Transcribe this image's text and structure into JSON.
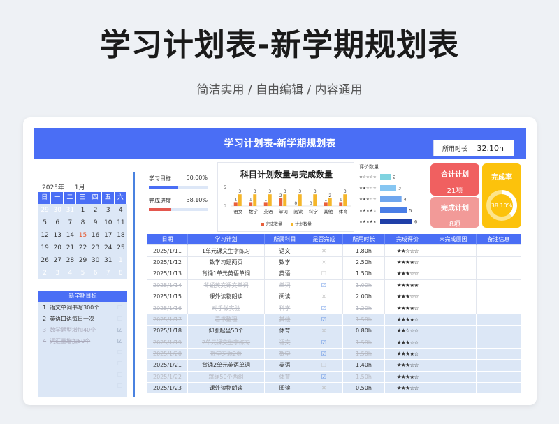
{
  "hero": {
    "title": "学习计划表-新学期规划表",
    "subtitle": "简洁实用 / 自由编辑 / 内容通用"
  },
  "sheet": {
    "title": "学习计划表-新学期规划表",
    "time_used_label": "所用时长",
    "time_used_value": "32.10h"
  },
  "calendar": {
    "year": "2025年",
    "month": "1月",
    "weekdays": [
      "日",
      "一",
      "二",
      "三",
      "四",
      "五",
      "六"
    ],
    "days": [
      {
        "d": "29",
        "m": true
      },
      {
        "d": "30",
        "m": true
      },
      {
        "d": "31",
        "m": true
      },
      {
        "d": "1"
      },
      {
        "d": "2"
      },
      {
        "d": "3"
      },
      {
        "d": "4"
      },
      {
        "d": "5"
      },
      {
        "d": "6"
      },
      {
        "d": "7"
      },
      {
        "d": "8"
      },
      {
        "d": "9"
      },
      {
        "d": "10"
      },
      {
        "d": "11"
      },
      {
        "d": "12"
      },
      {
        "d": "13"
      },
      {
        "d": "14"
      },
      {
        "d": "15",
        "t": true
      },
      {
        "d": "16"
      },
      {
        "d": "17"
      },
      {
        "d": "18"
      },
      {
        "d": "19"
      },
      {
        "d": "20"
      },
      {
        "d": "21"
      },
      {
        "d": "22"
      },
      {
        "d": "23"
      },
      {
        "d": "24"
      },
      {
        "d": "25"
      },
      {
        "d": "26"
      },
      {
        "d": "27"
      },
      {
        "d": "28"
      },
      {
        "d": "29"
      },
      {
        "d": "30"
      },
      {
        "d": "31"
      },
      {
        "d": "1",
        "m": true
      },
      {
        "d": "2",
        "m": true
      },
      {
        "d": "3",
        "m": true
      },
      {
        "d": "4",
        "m": true
      },
      {
        "d": "5",
        "m": true
      },
      {
        "d": "6",
        "m": true
      },
      {
        "d": "7",
        "m": true
      },
      {
        "d": "8",
        "m": true
      }
    ]
  },
  "goals": {
    "title": "新学期目标",
    "items": [
      {
        "n": "1",
        "text": "语文单词书写300个",
        "done": false
      },
      {
        "n": "2",
        "text": "英语口语每日一次",
        "done": false
      },
      {
        "n": "3",
        "text": "数学题型增加40个",
        "done": true
      },
      {
        "n": "4",
        "text": "词汇量增加50个",
        "done": true
      },
      {
        "n": "",
        "text": "",
        "done": false
      },
      {
        "n": "",
        "text": "",
        "done": false
      },
      {
        "n": "",
        "text": "",
        "done": false
      },
      {
        "n": "",
        "text": "",
        "done": false
      }
    ]
  },
  "stats": {
    "goal_label": "学习目标",
    "goal_value": "50.00%",
    "goal_fraction": 0.5,
    "goal_color": "#4a6ef5",
    "progress_label": "完成进度",
    "progress_value": "38.10%",
    "progress_fraction": 0.381,
    "progress_color": "#e4574e"
  },
  "chart_data": {
    "type": "bar",
    "title": "科目计划数量与完成数量",
    "categories": [
      "语文",
      "数学",
      "英语",
      "单词",
      "阅读",
      "科学",
      "其他",
      "体育"
    ],
    "series": [
      {
        "name": "完成数量",
        "values": [
          1,
          1,
          1,
          2,
          0,
          0,
          1,
          1
        ],
        "color": "#e8603c"
      },
      {
        "name": "计划数量",
        "values": [
          3,
          3,
          3,
          3,
          3,
          3,
          2,
          3
        ],
        "color": "#f5b62a"
      }
    ],
    "ylim": [
      0,
      5
    ],
    "yticks": [
      "5",
      "0"
    ]
  },
  "rating": {
    "title": "评价数量",
    "rows": [
      {
        "stars": "★☆☆☆☆",
        "value": 2,
        "color": "#7fd3e0"
      },
      {
        "stars": "★★☆☆☆",
        "value": 3,
        "color": "#86c6f2"
      },
      {
        "stars": "★★★☆☆",
        "value": 4,
        "color": "#6fa6ee"
      },
      {
        "stars": "★★★★☆",
        "value": 5,
        "color": "#4a7ee6"
      },
      {
        "stars": "★★★★★",
        "value": 6,
        "color": "#1f3fa8"
      }
    ],
    "max": 6
  },
  "kpi": {
    "total_label": "合计计划",
    "total_value": "21项",
    "done_label": "完成计划",
    "done_value": "8项",
    "rate_label": "完成率",
    "rate_value": "38.10%",
    "rate_fraction": 0.381
  },
  "table": {
    "headers": [
      "日期",
      "学习计划",
      "所属科目",
      "是否完成",
      "所用时长",
      "完成评价",
      "未完成原因",
      "备注信息"
    ],
    "rows": [
      {
        "date": "2025/1/11",
        "plan": "1单元课文生字练习",
        "subject": "语文",
        "done": false,
        "status": "x",
        "time": "1.80h",
        "stars": "★★☆☆☆",
        "blue": false
      },
      {
        "date": "2025/1/12",
        "plan": "数学习题两页",
        "subject": "数学",
        "done": false,
        "status": "x",
        "time": "2.50h",
        "stars": "★★★★☆",
        "blue": false
      },
      {
        "date": "2025/1/13",
        "plan": "背诵1单元英语单词",
        "subject": "英语",
        "done": false,
        "status": "o",
        "time": "1.50h",
        "stars": "★★★☆☆",
        "blue": false
      },
      {
        "date": "2025/1/14",
        "plan": "背诵英文课文单词",
        "subject": "单词",
        "done": true,
        "status": "v",
        "time": "1.00h",
        "stars": "★★★★★",
        "blue": false
      },
      {
        "date": "2025/1/15",
        "plan": "课外读物朗读",
        "subject": "阅读",
        "done": false,
        "status": "x",
        "time": "2.00h",
        "stars": "★★★☆☆",
        "blue": false
      },
      {
        "date": "2025/1/16",
        "plan": "动手做实验",
        "subject": "科学",
        "done": true,
        "status": "v",
        "time": "1.20h",
        "stars": "★★★★☆",
        "blue": false
      },
      {
        "date": "2025/1/17",
        "plan": "看书整理",
        "subject": "其他",
        "done": true,
        "status": "v",
        "time": "1.50h",
        "stars": "★★★★☆",
        "blue": true
      },
      {
        "date": "2025/1/18",
        "plan": "仰卧起坐50个",
        "subject": "体育",
        "done": false,
        "status": "x",
        "time": "0.80h",
        "stars": "★★☆☆☆",
        "blue": true
      },
      {
        "date": "2025/1/19",
        "plan": "2单元课文生字练习",
        "subject": "语文",
        "done": true,
        "status": "v",
        "time": "1.50h",
        "stars": "★★★☆☆",
        "blue": true
      },
      {
        "date": "2025/1/20",
        "plan": "数学习题2页",
        "subject": "数学",
        "done": true,
        "status": "v",
        "time": "1.50h",
        "stars": "★★★★☆",
        "blue": true
      },
      {
        "date": "2025/1/21",
        "plan": "背诵2单元英语单词",
        "subject": "英语",
        "done": false,
        "status": "o",
        "time": "1.40h",
        "stars": "★★★☆☆",
        "blue": true
      },
      {
        "date": "2025/1/22",
        "plan": "跳绳50个两组",
        "subject": "体育",
        "done": true,
        "status": "v",
        "time": "1.50h",
        "stars": "★★★★☆",
        "blue": true
      },
      {
        "date": "2025/1/23",
        "plan": "课外读物朗读",
        "subject": "阅读",
        "done": false,
        "status": "x",
        "time": "0.50h",
        "stars": "★★★☆☆",
        "blue": true
      }
    ]
  }
}
